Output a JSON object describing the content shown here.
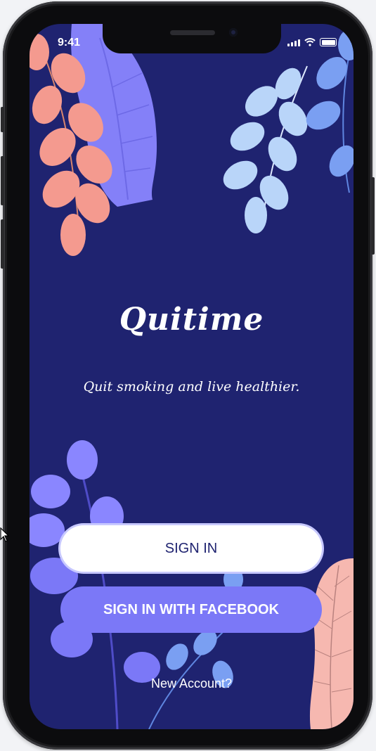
{
  "status_bar": {
    "time": "9:41"
  },
  "app": {
    "title": "Quitime",
    "tagline": "Quit smoking and live healthier."
  },
  "actions": {
    "sign_in_label": "SIGN IN",
    "facebook_label": "SIGN IN WITH FACEBOOK",
    "new_account_label": "New Account?"
  },
  "colors": {
    "background": "#1f2370",
    "primary_accent": "#7b78f7",
    "coral_leaves": "#f49a8f",
    "light_blue_leaves": "#b9d5f9",
    "blue_leaves": "#7a9ff2",
    "purple_leaves": "#8a86ff"
  },
  "icons": [
    "signal-icon",
    "wifi-icon",
    "battery-icon"
  ]
}
